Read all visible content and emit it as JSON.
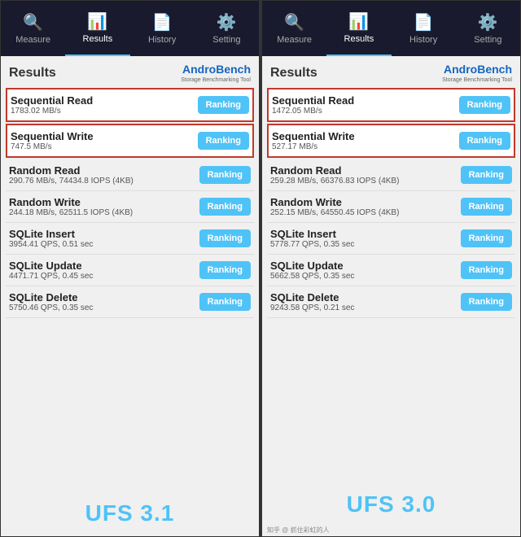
{
  "phones": [
    {
      "id": "left",
      "nav": {
        "items": [
          {
            "label": "Measure",
            "icon": "🔍",
            "active": false
          },
          {
            "label": "Results",
            "icon": "📊",
            "active": true
          },
          {
            "label": "History",
            "icon": "📄",
            "active": false
          },
          {
            "label": "Setting",
            "icon": "⚙️",
            "active": false
          }
        ]
      },
      "header": {
        "title": "Results",
        "logo_main": "AndroBench",
        "logo_sub": "Storage Benchmarking Tool"
      },
      "benchmarks": [
        {
          "name": "Sequential Read",
          "value": "1783.02 MB/s",
          "highlighted": true
        },
        {
          "name": "Sequential Write",
          "value": "747.5 MB/s",
          "highlighted": true
        },
        {
          "name": "Random Read",
          "value": "290.76 MB/s, 74434.8 IOPS (4KB)",
          "highlighted": false
        },
        {
          "name": "Random Write",
          "value": "244.18 MB/s, 62511.5 IOPS (4KB)",
          "highlighted": false
        },
        {
          "name": "SQLite Insert",
          "value": "3954.41 QPS, 0.51 sec",
          "highlighted": false
        },
        {
          "name": "SQLite Update",
          "value": "4471.71 QPS, 0.45 sec",
          "highlighted": false
        },
        {
          "name": "SQLite Delete",
          "value": "5750.46 QPS, 0.35 sec",
          "highlighted": false
        }
      ],
      "ufs_label": "UFS 3.1",
      "ranking_label": "Ranking"
    },
    {
      "id": "right",
      "nav": {
        "items": [
          {
            "label": "Measure",
            "icon": "🔍",
            "active": false
          },
          {
            "label": "Results",
            "icon": "📊",
            "active": true
          },
          {
            "label": "History",
            "icon": "📄",
            "active": false
          },
          {
            "label": "Setting",
            "icon": "⚙️",
            "active": false
          }
        ]
      },
      "header": {
        "title": "Results",
        "logo_main": "AndroBench",
        "logo_sub": "Storage Benchmarking Tool"
      },
      "benchmarks": [
        {
          "name": "Sequential Read",
          "value": "1472.05 MB/s",
          "highlighted": true
        },
        {
          "name": "Sequential Write",
          "value": "527.17 MB/s",
          "highlighted": true
        },
        {
          "name": "Random Read",
          "value": "259.28 MB/s, 66376.83 IOPS (4KB)",
          "highlighted": false
        },
        {
          "name": "Random Write",
          "value": "252.15 MB/s, 64550.45 IOPS (4KB)",
          "highlighted": false
        },
        {
          "name": "SQLite Insert",
          "value": "5778.77 QPS, 0.35 sec",
          "highlighted": false
        },
        {
          "name": "SQLite Update",
          "value": "5662.58 QPS, 0.35 sec",
          "highlighted": false
        },
        {
          "name": "SQLite Delete",
          "value": "9243.58 QPS, 0.21 sec",
          "highlighted": false
        }
      ],
      "ufs_label": "UFS 3.0",
      "ranking_label": "Ranking"
    }
  ],
  "watermark_left": "",
  "watermark_right": "知乎 @ 抓住彩虹的人"
}
